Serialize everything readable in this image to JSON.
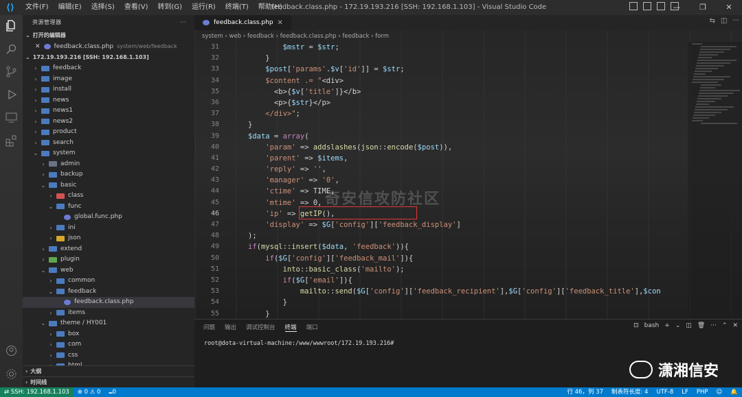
{
  "titlebar": {
    "menus": [
      "文件(F)",
      "编辑(E)",
      "选择(S)",
      "查看(V)",
      "转到(G)",
      "运行(R)",
      "终端(T)",
      "帮助(H)"
    ],
    "title": "feedback.class.php - 172.19.193.216 [SSH: 192.168.1.103] - Visual Studio Code"
  },
  "sidebar": {
    "title": "资源管理器",
    "open_editors_label": "打开的编辑器",
    "open_file": {
      "name": "feedback.class.php",
      "path": "system/web/feedback"
    },
    "workspace_label": "172.19.193.216 [SSH: 192.168.1.103]",
    "tree": [
      {
        "label": "feedback",
        "chev": "›",
        "kind": "fold",
        "indent": 0
      },
      {
        "label": "image",
        "chev": "›",
        "kind": "fold",
        "indent": 0
      },
      {
        "label": "install",
        "chev": "›",
        "kind": "fold",
        "indent": 0
      },
      {
        "label": "news",
        "chev": "›",
        "kind": "fold",
        "indent": 0
      },
      {
        "label": "news1",
        "chev": "›",
        "kind": "fold",
        "indent": 0
      },
      {
        "label": "news2",
        "chev": "›",
        "kind": "fold",
        "indent": 0
      },
      {
        "label": "product",
        "chev": "›",
        "kind": "fold",
        "indent": 0
      },
      {
        "label": "search",
        "chev": "›",
        "kind": "fold",
        "indent": 0
      },
      {
        "label": "system",
        "chev": "⌄",
        "kind": "fold",
        "indent": 0
      },
      {
        "label": "admin",
        "chev": "›",
        "kind": "gry",
        "indent": 1
      },
      {
        "label": "backup",
        "chev": "›",
        "kind": "fold",
        "indent": 1
      },
      {
        "label": "basic",
        "chev": "⌄",
        "kind": "fold",
        "indent": 1
      },
      {
        "label": "class",
        "chev": "›",
        "kind": "red",
        "indent": 2
      },
      {
        "label": "func",
        "chev": "⌄",
        "kind": "fold",
        "indent": 2
      },
      {
        "label": "global.func.php",
        "chev": "",
        "kind": "php",
        "indent": 3
      },
      {
        "label": "ini",
        "chev": "›",
        "kind": "fold",
        "indent": 2
      },
      {
        "label": "json",
        "chev": "›",
        "kind": "yel",
        "indent": 2
      },
      {
        "label": "extend",
        "chev": "›",
        "kind": "fold",
        "indent": 1
      },
      {
        "label": "plugin",
        "chev": "›",
        "kind": "grn",
        "indent": 1
      },
      {
        "label": "web",
        "chev": "⌄",
        "kind": "fold",
        "indent": 1
      },
      {
        "label": "common",
        "chev": "›",
        "kind": "fold",
        "indent": 2
      },
      {
        "label": "feedback",
        "chev": "⌄",
        "kind": "fold",
        "indent": 2
      },
      {
        "label": "feedback.class.php",
        "chev": "",
        "kind": "php",
        "indent": 3,
        "selected": true
      },
      {
        "label": "items",
        "chev": "›",
        "kind": "fold",
        "indent": 2
      },
      {
        "label": "theme / HY001",
        "chev": "⌄",
        "kind": "fold",
        "indent": 1
      },
      {
        "label": "box",
        "chev": "›",
        "kind": "fold",
        "indent": 2
      },
      {
        "label": "com",
        "chev": "›",
        "kind": "fold",
        "indent": 2
      },
      {
        "label": "css",
        "chev": "›",
        "kind": "fold",
        "indent": 2
      },
      {
        "label": "html",
        "chev": "›",
        "kind": "fold",
        "indent": 2
      }
    ],
    "outline_label": "大纲",
    "timeline_label": "时间线"
  },
  "editor": {
    "tab_label": "feedback.class.php",
    "breadcrumb": [
      "system",
      "web",
      "feedback",
      "feedback.class.php",
      "feedback",
      "form"
    ],
    "lines": [
      {
        "n": "31",
        "code": "                    $mstr = $str;"
      },
      {
        "n": "32",
        "code": "                }"
      },
      {
        "n": "33",
        "code": "                $post['params'.$v['id']] = $str;"
      },
      {
        "n": "34",
        "code": "                $content .= \"<div>"
      },
      {
        "n": "35",
        "code": "                  <b>{$v['title']}</b>"
      },
      {
        "n": "36",
        "code": "                  <p>{$str}</p>"
      },
      {
        "n": "37",
        "code": "                </div>\";"
      },
      {
        "n": "38",
        "code": "            }"
      },
      {
        "n": "39",
        "code": "            $data = array("
      },
      {
        "n": "40",
        "code": "                'param' => addslashes(json::encode($post)),"
      },
      {
        "n": "41",
        "code": "                'parent' => $items,"
      },
      {
        "n": "42",
        "code": "                'reply' => '',"
      },
      {
        "n": "43",
        "code": "                'manager' => '0',"
      },
      {
        "n": "44",
        "code": "                'ctime' => TIME,"
      },
      {
        "n": "45",
        "code": "                'mtime' => 0,"
      },
      {
        "n": "46",
        "code": "                'ip' => getIP(),"
      },
      {
        "n": "47",
        "code": "                'display' => $G['config']['feedback_display']"
      },
      {
        "n": "48",
        "code": "            );"
      },
      {
        "n": "49",
        "code": "            if(mysql::insert($data, 'feedback')){"
      },
      {
        "n": "50",
        "code": "                if($G['config']['feedback_mail']){"
      },
      {
        "n": "51",
        "code": "                    into::basic_class('mailto');"
      },
      {
        "n": "52",
        "code": "                    if($G['email']){"
      },
      {
        "n": "53",
        "code": "                        mailto::send($G['config']['feedback_recipient'],$G['config']['feedback_title'],$con"
      },
      {
        "n": "54",
        "code": "                    }"
      },
      {
        "n": "55",
        "code": "                }"
      }
    ],
    "watermark": "奇安信攻防社区"
  },
  "panel": {
    "tabs": [
      "问题",
      "输出",
      "调试控制台",
      "终端",
      "端口"
    ],
    "active": "终端",
    "shell": "bash",
    "terminal_line": "root@dota-virtual-machine:/www/wwwroot/172.19.193.216#"
  },
  "brand": {
    "text": "潇湘信安"
  },
  "status": {
    "remote": "SSH: 192.168.1.103",
    "problems": "⊗ 0 ⚠ 0",
    "ports": "⑉0",
    "position": "行 46，列 37",
    "tabs": "制表符长度: 4",
    "encoding": "UTF-8",
    "eol": "LF",
    "lang": "PHP"
  },
  "colors": {
    "accent": "#007acc",
    "remote": "#16825d",
    "highlight": "#e53935"
  }
}
